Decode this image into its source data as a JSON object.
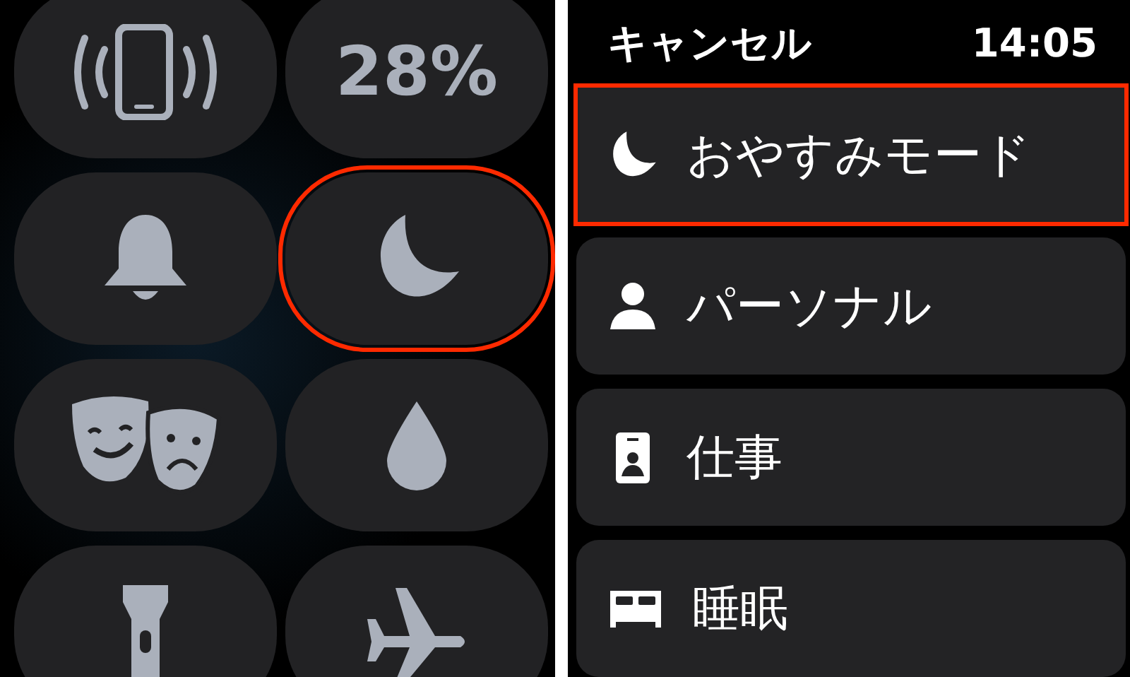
{
  "control_center": {
    "tiles": [
      {
        "kind": "phone-ping",
        "highlighted": false
      },
      {
        "kind": "battery",
        "label": "28%",
        "highlighted": false
      },
      {
        "kind": "bell",
        "highlighted": false
      },
      {
        "kind": "moon",
        "highlighted": true
      },
      {
        "kind": "masks",
        "highlighted": false
      },
      {
        "kind": "drop",
        "highlighted": false
      },
      {
        "kind": "flashlight",
        "highlighted": false
      },
      {
        "kind": "airplane",
        "highlighted": false
      }
    ]
  },
  "focus_menu": {
    "cancel": "キャンセル",
    "time": "14:05",
    "items": [
      {
        "kind": "moon",
        "label": "おやすみモード",
        "highlighted": true
      },
      {
        "kind": "person",
        "label": "パーソナル",
        "highlighted": false
      },
      {
        "kind": "badge",
        "label": "仕事",
        "highlighted": false
      },
      {
        "kind": "bed",
        "label": "睡眠",
        "highlighted": false
      }
    ]
  }
}
